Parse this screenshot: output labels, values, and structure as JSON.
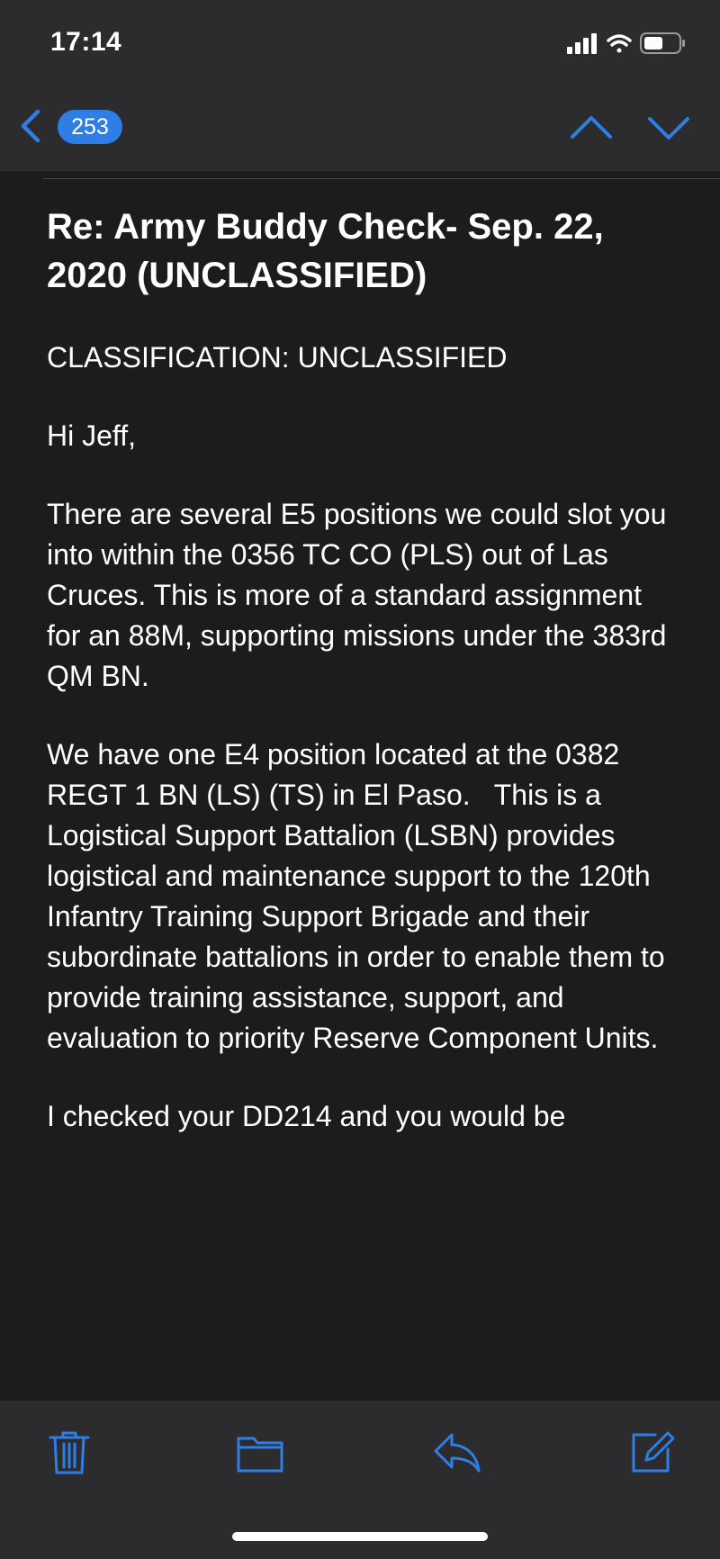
{
  "status": {
    "time": "17:14",
    "icons": [
      "cellular-signal-icon",
      "wifi-icon",
      "battery-icon"
    ]
  },
  "nav": {
    "back_icon": "chevron-left-icon",
    "message_count": "253",
    "up_icon": "chevron-up-icon",
    "down_icon": "chevron-down-icon"
  },
  "email": {
    "subject": "Re: Army Buddy Check- Sep. 22, 2020 (UNCLASSIFIED)",
    "classification": "CLASSIFICATION: UNCLASSIFIED",
    "greeting": "Hi Jeff,",
    "paragraph1": "There are several E5 positions we could slot you into within the 0356 TC CO (PLS) out of Las Cruces. This is more of a standard assignment for an 88M, supporting missions under the 383rd QM BN.",
    "paragraph2": "We have one E4 position located at the 0382 REGT 1 BN (LS) (TS) in El Paso.   This is a Logistical Support Battalion (LSBN) provides logistical and maintenance support to the 120th Infantry Training Support Brigade and their subordinate battalions in order to enable them to provide training assistance, support, and evaluation to priority Reserve Component Units.",
    "paragraph3_partial": "I checked your DD214 and you would be"
  },
  "toolbar": {
    "items": [
      "trash-icon",
      "folder-icon",
      "reply-icon",
      "compose-icon"
    ]
  },
  "colors": {
    "accent": "#2f7ee5",
    "background": "#1c1c1e",
    "bar": "#2c2c2e"
  }
}
